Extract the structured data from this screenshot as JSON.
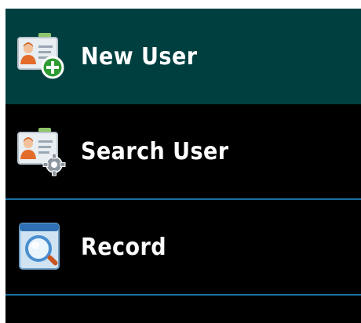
{
  "menu": {
    "items": [
      {
        "label": "New User",
        "icon": "add-user-icon",
        "selected": true
      },
      {
        "label": "Search User",
        "icon": "search-user-icon",
        "selected": false
      },
      {
        "label": "Record",
        "icon": "record-search-icon",
        "selected": false
      }
    ]
  },
  "colors": {
    "background": "#000000",
    "selected_bg": "#003f40",
    "divider": "#1a6fa3",
    "text": "#ffffff"
  }
}
